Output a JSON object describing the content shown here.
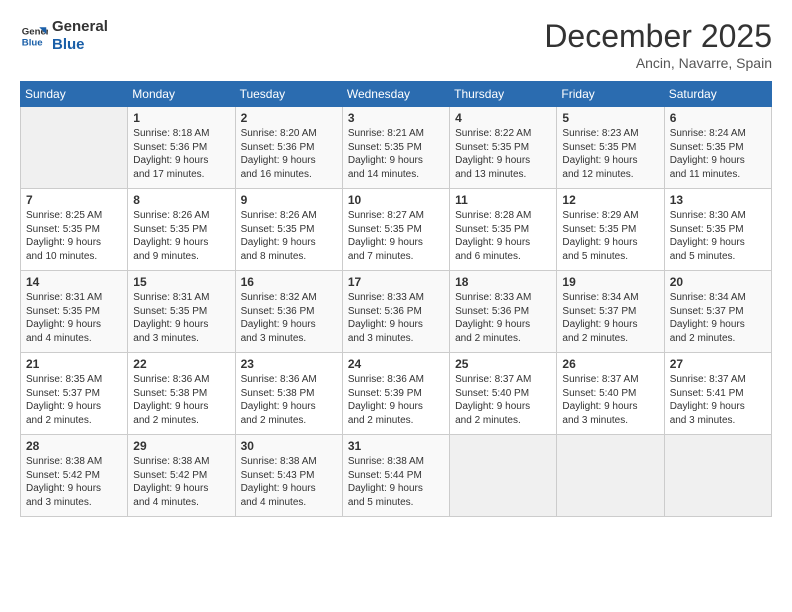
{
  "header": {
    "logo_line1": "General",
    "logo_line2": "Blue",
    "month": "December 2025",
    "location": "Ancin, Navarre, Spain"
  },
  "days_of_week": [
    "Sunday",
    "Monday",
    "Tuesday",
    "Wednesday",
    "Thursday",
    "Friday",
    "Saturday"
  ],
  "weeks": [
    [
      {
        "num": "",
        "info": ""
      },
      {
        "num": "1",
        "info": "Sunrise: 8:18 AM\nSunset: 5:36 PM\nDaylight: 9 hours\nand 17 minutes."
      },
      {
        "num": "2",
        "info": "Sunrise: 8:20 AM\nSunset: 5:36 PM\nDaylight: 9 hours\nand 16 minutes."
      },
      {
        "num": "3",
        "info": "Sunrise: 8:21 AM\nSunset: 5:35 PM\nDaylight: 9 hours\nand 14 minutes."
      },
      {
        "num": "4",
        "info": "Sunrise: 8:22 AM\nSunset: 5:35 PM\nDaylight: 9 hours\nand 13 minutes."
      },
      {
        "num": "5",
        "info": "Sunrise: 8:23 AM\nSunset: 5:35 PM\nDaylight: 9 hours\nand 12 minutes."
      },
      {
        "num": "6",
        "info": "Sunrise: 8:24 AM\nSunset: 5:35 PM\nDaylight: 9 hours\nand 11 minutes."
      }
    ],
    [
      {
        "num": "7",
        "info": "Sunrise: 8:25 AM\nSunset: 5:35 PM\nDaylight: 9 hours\nand 10 minutes."
      },
      {
        "num": "8",
        "info": "Sunrise: 8:26 AM\nSunset: 5:35 PM\nDaylight: 9 hours\nand 9 minutes."
      },
      {
        "num": "9",
        "info": "Sunrise: 8:26 AM\nSunset: 5:35 PM\nDaylight: 9 hours\nand 8 minutes."
      },
      {
        "num": "10",
        "info": "Sunrise: 8:27 AM\nSunset: 5:35 PM\nDaylight: 9 hours\nand 7 minutes."
      },
      {
        "num": "11",
        "info": "Sunrise: 8:28 AM\nSunset: 5:35 PM\nDaylight: 9 hours\nand 6 minutes."
      },
      {
        "num": "12",
        "info": "Sunrise: 8:29 AM\nSunset: 5:35 PM\nDaylight: 9 hours\nand 5 minutes."
      },
      {
        "num": "13",
        "info": "Sunrise: 8:30 AM\nSunset: 5:35 PM\nDaylight: 9 hours\nand 5 minutes."
      }
    ],
    [
      {
        "num": "14",
        "info": "Sunrise: 8:31 AM\nSunset: 5:35 PM\nDaylight: 9 hours\nand 4 minutes."
      },
      {
        "num": "15",
        "info": "Sunrise: 8:31 AM\nSunset: 5:35 PM\nDaylight: 9 hours\nand 3 minutes."
      },
      {
        "num": "16",
        "info": "Sunrise: 8:32 AM\nSunset: 5:36 PM\nDaylight: 9 hours\nand 3 minutes."
      },
      {
        "num": "17",
        "info": "Sunrise: 8:33 AM\nSunset: 5:36 PM\nDaylight: 9 hours\nand 3 minutes."
      },
      {
        "num": "18",
        "info": "Sunrise: 8:33 AM\nSunset: 5:36 PM\nDaylight: 9 hours\nand 2 minutes."
      },
      {
        "num": "19",
        "info": "Sunrise: 8:34 AM\nSunset: 5:37 PM\nDaylight: 9 hours\nand 2 minutes."
      },
      {
        "num": "20",
        "info": "Sunrise: 8:34 AM\nSunset: 5:37 PM\nDaylight: 9 hours\nand 2 minutes."
      }
    ],
    [
      {
        "num": "21",
        "info": "Sunrise: 8:35 AM\nSunset: 5:37 PM\nDaylight: 9 hours\nand 2 minutes."
      },
      {
        "num": "22",
        "info": "Sunrise: 8:36 AM\nSunset: 5:38 PM\nDaylight: 9 hours\nand 2 minutes."
      },
      {
        "num": "23",
        "info": "Sunrise: 8:36 AM\nSunset: 5:38 PM\nDaylight: 9 hours\nand 2 minutes."
      },
      {
        "num": "24",
        "info": "Sunrise: 8:36 AM\nSunset: 5:39 PM\nDaylight: 9 hours\nand 2 minutes."
      },
      {
        "num": "25",
        "info": "Sunrise: 8:37 AM\nSunset: 5:40 PM\nDaylight: 9 hours\nand 2 minutes."
      },
      {
        "num": "26",
        "info": "Sunrise: 8:37 AM\nSunset: 5:40 PM\nDaylight: 9 hours\nand 3 minutes."
      },
      {
        "num": "27",
        "info": "Sunrise: 8:37 AM\nSunset: 5:41 PM\nDaylight: 9 hours\nand 3 minutes."
      }
    ],
    [
      {
        "num": "28",
        "info": "Sunrise: 8:38 AM\nSunset: 5:42 PM\nDaylight: 9 hours\nand 3 minutes."
      },
      {
        "num": "29",
        "info": "Sunrise: 8:38 AM\nSunset: 5:42 PM\nDaylight: 9 hours\nand 4 minutes."
      },
      {
        "num": "30",
        "info": "Sunrise: 8:38 AM\nSunset: 5:43 PM\nDaylight: 9 hours\nand 4 minutes."
      },
      {
        "num": "31",
        "info": "Sunrise: 8:38 AM\nSunset: 5:44 PM\nDaylight: 9 hours\nand 5 minutes."
      },
      {
        "num": "",
        "info": ""
      },
      {
        "num": "",
        "info": ""
      },
      {
        "num": "",
        "info": ""
      }
    ]
  ]
}
